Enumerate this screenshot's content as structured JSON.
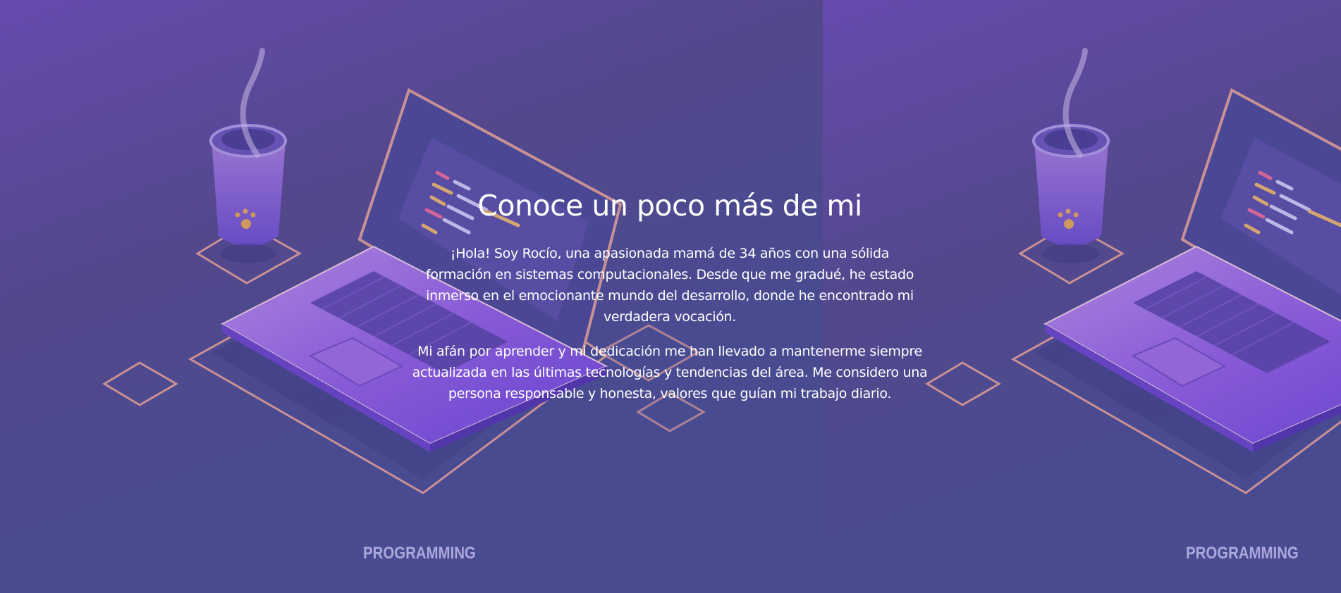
{
  "about": {
    "title": "Conoce un poco más de mi",
    "paragraphs": [
      "¡Hola! Soy Rocío, una apasionada mamá de 34 años con una sólida formación en sistemas computacionales. Desde que me gradué, he estado inmerso en el emocionante mundo del desarrollo, donde he encontrado mi verdadera vocación.",
      "Mi afán por aprender y mi dedicación me han llevado a mantenerme siempre actualizada en las últimas tecnologías y tendencias del área. Me considero una persona responsable y honesta, valores que guían mi trabajo diario."
    ]
  },
  "background": {
    "tiles": [
      {
        "caption": "PROGRAMMING"
      },
      {
        "caption": "PROGRAMMING"
      }
    ]
  },
  "colors": {
    "bg_top": "#6b4db3",
    "bg_bottom": "#4a4f92",
    "laptop_purple": "#8a5ee0",
    "outline_peach": "#d5989a",
    "caption": "#b6b2e6"
  }
}
